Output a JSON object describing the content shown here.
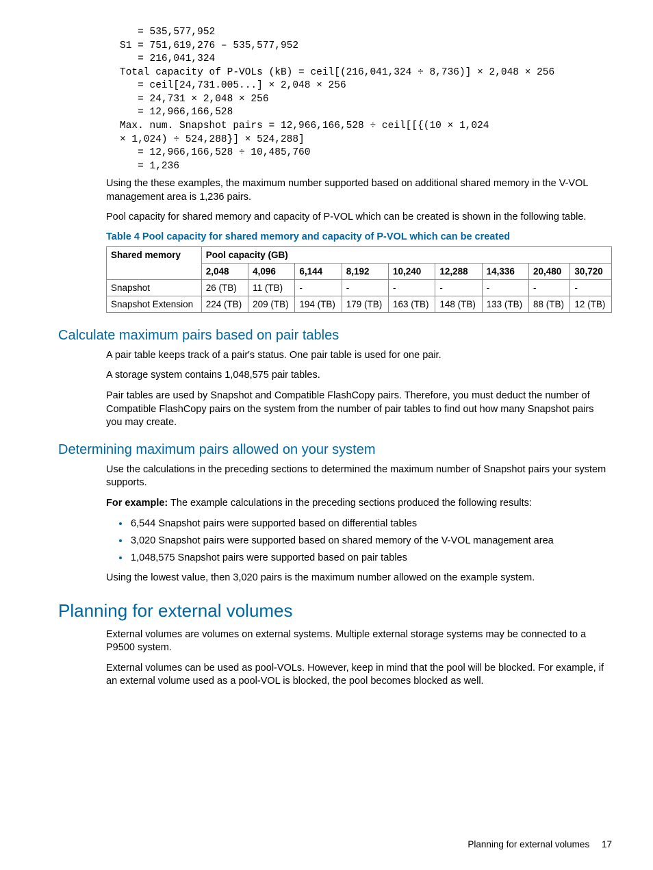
{
  "code_block": "   = 535,577,952\nS1 = 751,619,276 – 535,577,952\n   = 216,041,324\nTotal capacity of P-VOLs (kB) = ceil[(216,041,324 ÷ 8,736)] × 2,048 × 256\n   = ceil[24,731.005...] × 2,048 × 256\n   = 24,731 × 2,048 × 256\n   = 12,966,166,528\nMax. num. Snapshot pairs = 12,966,166,528 ÷ ceil[[{(10 × 1,024\n× 1,024) ÷ 524,288}] × 524,288]\n   = 12,966,166,528 ÷ 10,485,760\n   = 1,236",
  "para1": "Using the these examples, the maximum number supported based on additional shared memory in the V-VOL management area is 1,236 pairs.",
  "para2": "Pool capacity for shared memory and capacity of P-VOL which can be created is shown in the following table.",
  "table_caption": "Table 4 Pool capacity for shared memory and capacity of P-VOL which can be created",
  "chart_data": {
    "type": "table",
    "title": "Pool capacity for shared memory and capacity of P-VOL which can be created",
    "row_header": "Shared memory",
    "col_group_header": "Pool capacity (GB)",
    "columns": [
      "2,048",
      "4,096",
      "6,144",
      "8,192",
      "10,240",
      "12,288",
      "14,336",
      "20,480",
      "30,720"
    ],
    "rows": [
      {
        "name": "Snapshot",
        "values": [
          "26 (TB)",
          "11 (TB)",
          "-",
          "-",
          "-",
          "-",
          "-",
          "-",
          "-"
        ]
      },
      {
        "name": "Snapshot Extension",
        "values": [
          "224 (TB)",
          "209 (TB)",
          "194 (TB)",
          "179 (TB)",
          "163 (TB)",
          "148 (TB)",
          "133 (TB)",
          "88 (TB)",
          "12 (TB)"
        ]
      }
    ]
  },
  "h2a": "Calculate maximum pairs based on pair tables",
  "pt_p1": "A pair table keeps track of a pair's status. One pair table is used for one pair.",
  "pt_p2": "A storage system contains 1,048,575 pair tables.",
  "pt_p3": "Pair tables are used by Snapshot and Compatible FlashCopy pairs. Therefore, you must deduct the number of Compatible FlashCopy pairs on the system from the number of pair tables to find out how many Snapshot pairs you may create.",
  "h2b": "Determining maximum pairs allowed on your system",
  "dm_p1": "Use the calculations in the preceding sections to determined the maximum number of Snapshot pairs your system supports.",
  "dm_ex_label": "For example:",
  "dm_ex_text": " The example calculations in the preceding sections produced the following results:",
  "dm_bullets": [
    "6,544 Snapshot pairs were supported based on differential tables",
    "3,020 Snapshot pairs were supported based on shared memory of the V-VOL management area",
    "1,048,575 Snapshot pairs were supported based on pair tables"
  ],
  "dm_p2": "Using the lowest value, then 3,020 pairs is the maximum number allowed on the example system.",
  "h1a": "Planning for external volumes",
  "ev_p1": "External volumes are volumes on external systems. Multiple external storage systems may be connected to a P9500 system.",
  "ev_p2": "External volumes can be used as pool-VOLs. However, keep in mind that the pool will be blocked. For example, if an external volume used as a pool-VOL is blocked, the pool becomes blocked as well.",
  "footer_title": "Planning for external volumes",
  "footer_page": "17"
}
